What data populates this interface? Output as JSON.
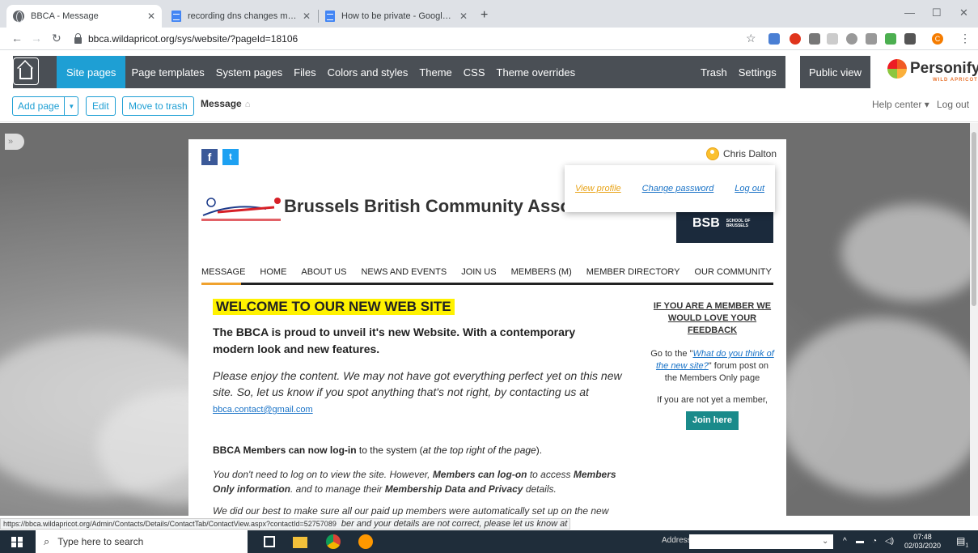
{
  "browser": {
    "tabs": [
      {
        "title": "BBCA - Message",
        "icon": "globe-icon"
      },
      {
        "title": "recording dns changes made - G",
        "icon": "docs-icon"
      },
      {
        "title": "How to be private - Google Docs",
        "icon": "docs-icon"
      }
    ],
    "url": "bbca.wildapricot.org/sys/website/?pageId=18106",
    "profile_initial": "C"
  },
  "admin": {
    "menu": [
      "Site pages",
      "Page templates",
      "System pages",
      "Files",
      "Colors and styles",
      "Theme",
      "CSS",
      "Theme overrides"
    ],
    "trash": "Trash",
    "settings": "Settings",
    "public_view": "Public view",
    "logo_name": "Personify",
    "logo_sub": "WILD APRICOT",
    "accent_color": "#1e9fd4"
  },
  "toolbar": {
    "add_page": "Add page",
    "edit": "Edit",
    "move_to_trash": "Move to trash",
    "breadcrumb": "Message",
    "help_center": "Help center",
    "logout": "Log out"
  },
  "site": {
    "user_name": "Chris Dalton",
    "popup": {
      "view_profile": "View profile",
      "change_password": "Change password",
      "log_out": "Log out"
    },
    "title": "Brussels British Community Association",
    "bsb_label": "BSB",
    "bsb_sub": "SCHOOL OF BRUSSELS",
    "nav": [
      "MESSAGE",
      "HOME",
      "ABOUT US",
      "NEWS AND EVENTS",
      "JOIN US",
      "MEMBERS (M)",
      "MEMBER DIRECTORY",
      "OUR COMMUNITY"
    ],
    "welcome": "WELCOME TO OUR NEW WEB SITE",
    "lead": "The BBCA is proud to unveil it's new Website.  With a contemporary modern look and new features.",
    "enjoy": "Please enjoy the content.  We may not have got everything perfect yet on this new site.  So, let us know if you spot anything that's not right, by contacting us at",
    "email": "bbca.contact@gmail.com",
    "login_bold": "BBCA Members can now log-in",
    "login_rest": " to the system (",
    "login_italic": "at the top right of the page",
    "login_end": ").",
    "dont_1": "You don't need to log on to view the site.  However, ",
    "dont_b1": "Members can log-on",
    "dont_2": " to access ",
    "dont_b2": "Members Only information",
    "dont_3": ". and to manage their ",
    "dont_b3": "Membership Data and Privacy",
    "dont_4": " details.",
    "we_did": "We did our best to make sure all our paid up members were automatically set up on the new",
    "we_did_2": "ber and your details are not correct, please let us know at",
    "side_heading": "IF YOU ARE A MEMBER  WE WOULD LOVE YOUR FEEDBACK",
    "side_goto": "Go to the \"",
    "side_link": "What do you think of the new site?",
    "side_post": "\"  forum post on the Members Only page",
    "side_notmember": "If you are not yet a member,",
    "join_here": "Join here"
  },
  "status_url": "https://bbca.wildapricot.org/Admin/Contacts/Details/ContactTab/ContactView.aspx?contactId=52757089",
  "taskbar": {
    "search_placeholder": "Type here to search",
    "address_label": "Address",
    "time": "07:48",
    "date": "02/03/2020",
    "notifications": "1"
  }
}
